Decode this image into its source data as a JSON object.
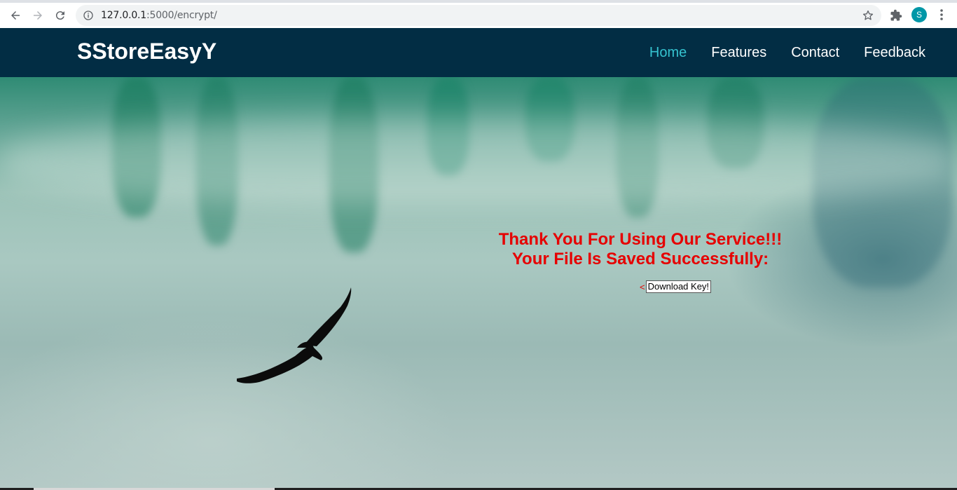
{
  "browser": {
    "url_host": "127.0.0.1",
    "url_path": ":5000/encrypt/",
    "profile_initial": "S",
    "icons": [
      "back-arrow-icon",
      "forward-arrow-icon",
      "reload-icon",
      "info-icon",
      "star-icon",
      "puzzle-icon",
      "kebab-menu-icon"
    ]
  },
  "site": {
    "brand": "SStoreEasyY",
    "nav": [
      {
        "label": "Home",
        "active": true
      },
      {
        "label": "Features",
        "active": false
      },
      {
        "label": "Contact",
        "active": false
      },
      {
        "label": "Feedback",
        "active": false
      }
    ]
  },
  "hero": {
    "line1": "Thank You For Using Our Service!!!",
    "line2": "Your File Is Saved Successfully:",
    "prefix_char": "<",
    "download_label": "Download Key!"
  },
  "colors": {
    "header_bg": "#022d44",
    "nav_active": "#35c2cf",
    "message": "#e60000"
  }
}
